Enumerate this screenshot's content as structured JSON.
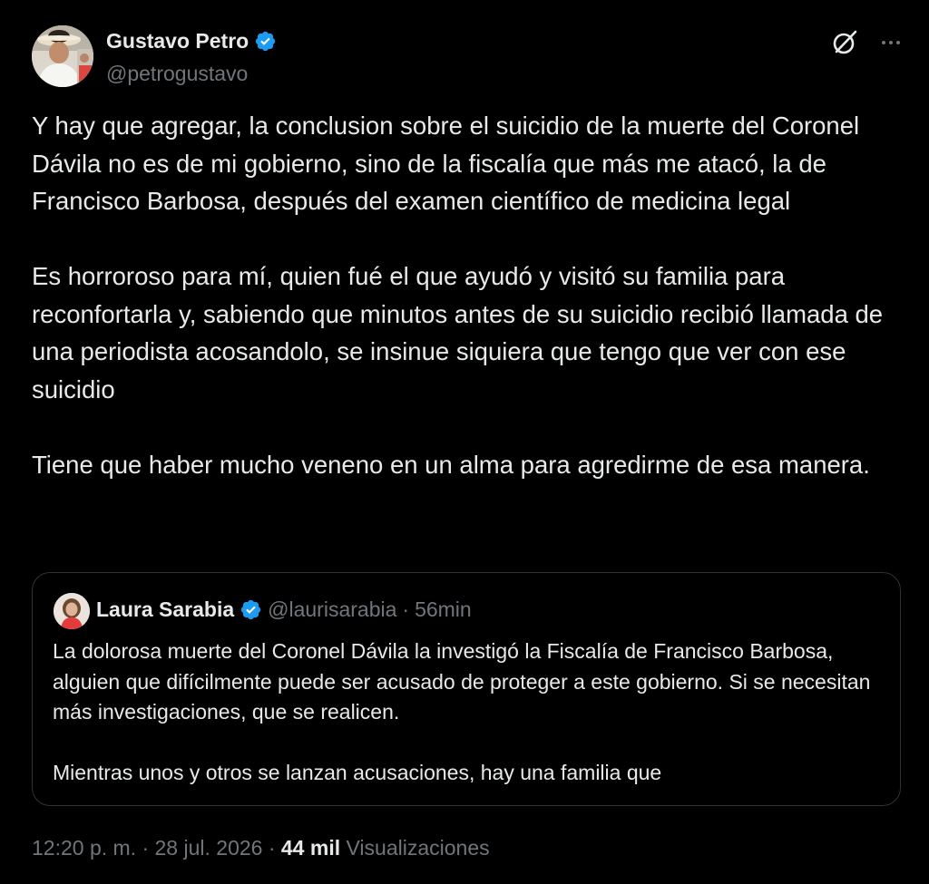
{
  "author": {
    "display_name": "Gustavo Petro",
    "handle": "@petrogustavo",
    "verified": true
  },
  "icons": {
    "verified": "verified-badge-icon",
    "grok": "grok-icon",
    "more": "more-options-icon"
  },
  "tweet": {
    "paragraphs": [
      "Y hay que agregar, la conclusion sobre el suicidio de la muerte del Coronel Dávila no es de mi gobierno, sino de la fiscalía que más me atacó, la de Francisco Barbosa, después del examen científico de medicina legal",
      "Es horroroso para mí, quien fué el que ayudó y visitó su familia para reconfortarla y, sabiendo que minutos antes de su suicidio recibió llamada de una periodista acosandolo, se insinue siquiera que tengo que ver con ese suicidio",
      "Tiene que haber mucho veneno en un alma para agredirme de esa manera."
    ]
  },
  "quoted": {
    "display_name": "Laura Sarabia",
    "handle": "@laurisarabia",
    "separator": "·",
    "time": "56min",
    "paragraphs": [
      "La dolorosa muerte del Coronel Dávila la investigó la Fiscalía de Francisco Barbosa, alguien que difícilmente puede ser acusado de proteger a este gobierno. Si se necesitan más investigaciones, que se realicen.",
      "Mientras unos y otros se lanzan acusaciones, hay una familia que"
    ]
  },
  "meta": {
    "timestamp": "12:20 p. m. · 28 jul. 2026 ·",
    "views_count": "44 mil",
    "views_label": "Visualizaciones"
  },
  "colors": {
    "background": "#000000",
    "text_primary": "#e7e9ea",
    "text_secondary": "#71767b",
    "verified_blue": "#1d9bf0",
    "border": "#2f3336"
  }
}
